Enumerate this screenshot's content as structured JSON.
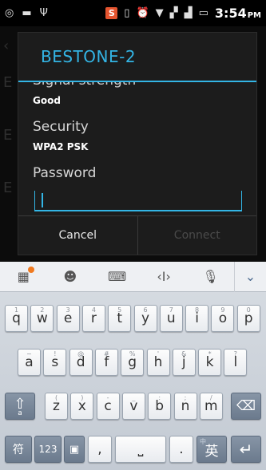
{
  "status_bar": {
    "time": "3:54",
    "ampm": "PM",
    "left_icons": [
      "target-icon",
      "usb-icon",
      "antenna-icon"
    ],
    "right_icons": [
      "app-badge-icon",
      "vibrate-icon",
      "alarm-icon",
      "wifi-icon",
      "signal-icon",
      "signal-icon-2",
      "battery-icon"
    ],
    "badge_letter": "S"
  },
  "dialog": {
    "title": "BESTONE-2",
    "clipped_label": "Signal strength",
    "signal_value": "Good",
    "security_label": "Security",
    "security_value": "WPA2 PSK",
    "password_label": "Password",
    "password_value": "",
    "cancel_label": "Cancel",
    "connect_label": "Connect",
    "accent_color": "#33b5e5"
  },
  "keyboard": {
    "toolbar": [
      "puzzle-icon",
      "emoji-icon",
      "keyboard-icon",
      "cursor-icon",
      "mic-icon",
      "chevron-down-icon"
    ],
    "row1": [
      {
        "k": "q",
        "h": "1"
      },
      {
        "k": "w",
        "h": "2"
      },
      {
        "k": "e",
        "h": "3"
      },
      {
        "k": "r",
        "h": "4"
      },
      {
        "k": "t",
        "h": "5"
      },
      {
        "k": "y",
        "h": "6"
      },
      {
        "k": "u",
        "h": "7"
      },
      {
        "k": "i",
        "h": "8"
      },
      {
        "k": "o",
        "h": "9"
      },
      {
        "k": "p",
        "h": "0"
      }
    ],
    "row2": [
      {
        "k": "a",
        "h": "~"
      },
      {
        "k": "s",
        "h": "!"
      },
      {
        "k": "d",
        "h": "@"
      },
      {
        "k": "f",
        "h": "#"
      },
      {
        "k": "g",
        "h": "%"
      },
      {
        "k": "h",
        "h": "'"
      },
      {
        "k": "j",
        "h": "&"
      },
      {
        "k": "k",
        "h": "*"
      },
      {
        "k": "l",
        "h": "?"
      }
    ],
    "row3": [
      {
        "k": "z",
        "h": "("
      },
      {
        "k": "x",
        "h": ")"
      },
      {
        "k": "c",
        "h": "-"
      },
      {
        "k": "v",
        "h": "_"
      },
      {
        "k": "b",
        "h": ":"
      },
      {
        "k": "n",
        "h": ";"
      },
      {
        "k": "m",
        "h": "/"
      }
    ],
    "shift_label": "⇧",
    "shift_sub": "a",
    "backspace_label": "⌫",
    "symbols_label": "符",
    "numbers_label": "123",
    "comma_label": ",",
    "space_label": "⎵",
    "period_label": ".",
    "lang_label": "英",
    "lang_hint": "中",
    "enter_label": "↵"
  }
}
